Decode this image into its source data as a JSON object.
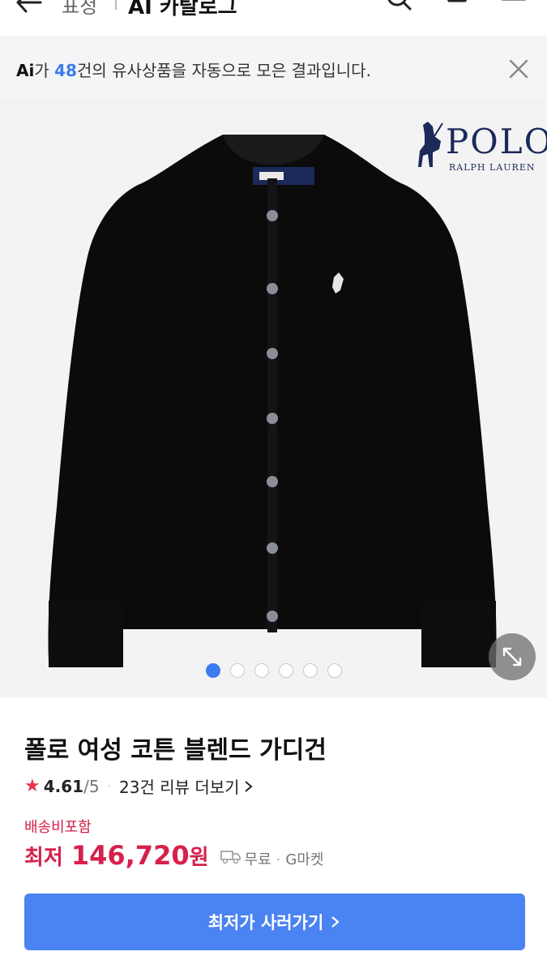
{
  "nav": {
    "crumb": "표정",
    "title": "AI 카탈로그",
    "icons": [
      "back-arrow-icon",
      "search-icon",
      "cart-icon",
      "menu-icon"
    ]
  },
  "banner": {
    "ai": "Ai",
    "pre": "가 ",
    "count": "48",
    "post": "건의 유사상품을 자동으로 모은 결과입니다."
  },
  "hero": {
    "logo_text": "POLO",
    "logo_sub": "RALPH LAUREN",
    "image_count": 6,
    "active_index": 0
  },
  "product": {
    "name": "폴로 여성 코튼 블렌드 가디건",
    "rating": "4.61",
    "rating_max": "/5",
    "reviews": "23건 리뷰 더보기",
    "shipping_included": "배송비포함",
    "price_label": "최저",
    "price": "146,720",
    "price_unit": "원",
    "shipping_fee": "무료",
    "store": "G마켓",
    "buy_button": "최저가 사러가기"
  },
  "colors": {
    "accent": "#4a83f2",
    "price": "#d6204b",
    "banner_bg": "#f4f5f7"
  }
}
